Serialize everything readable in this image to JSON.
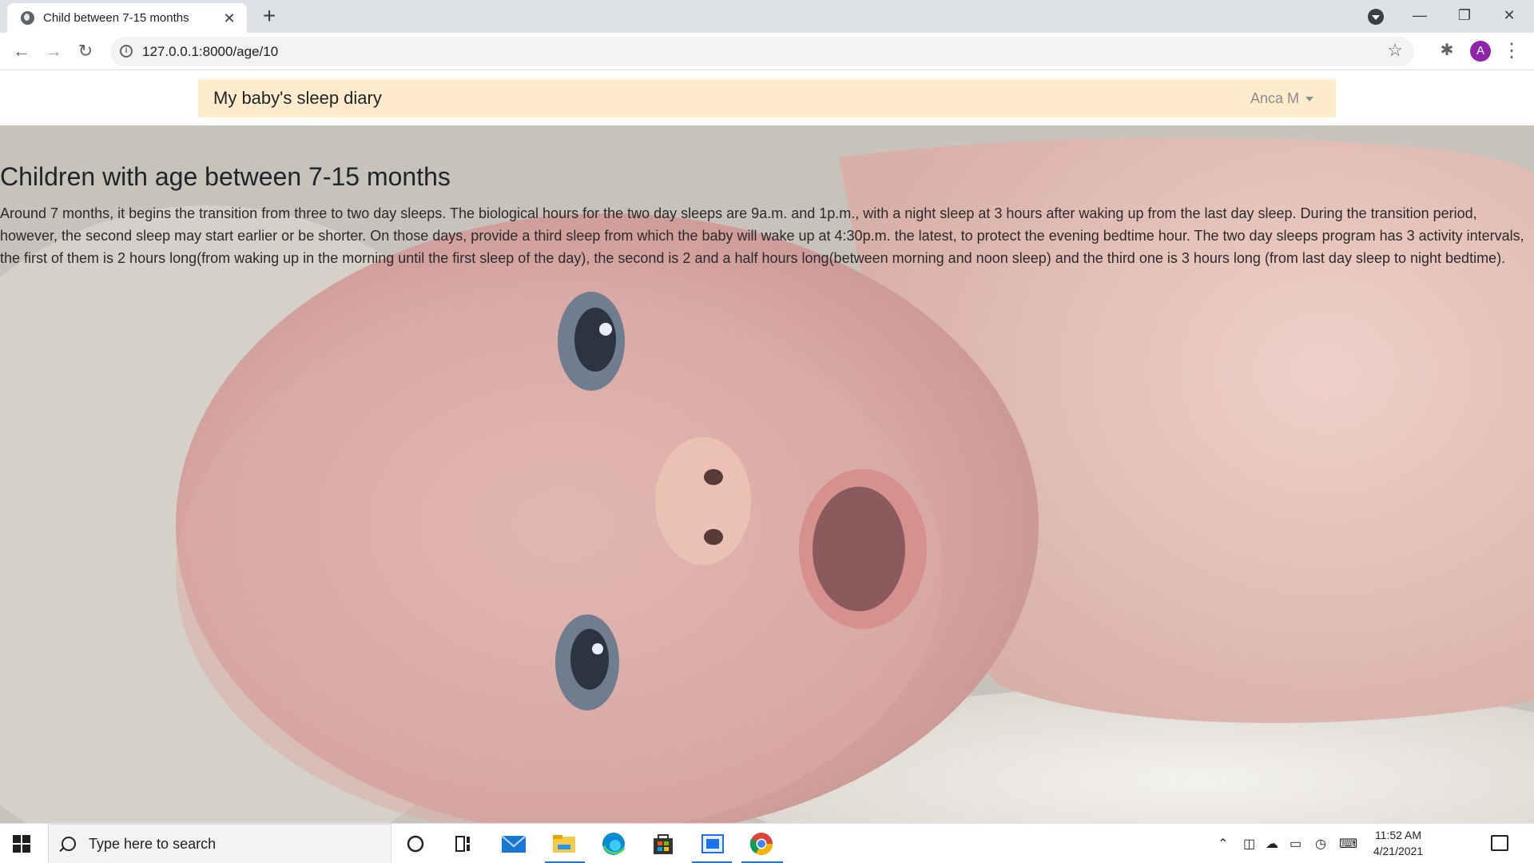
{
  "browser": {
    "tab_title": "Child between 7-15 months",
    "tab_close": "✕",
    "new_tab": "+",
    "url": "127.0.0.1:8000/age/10",
    "info_glyph": "i",
    "star_glyph": "☆",
    "avatar_letter": "A",
    "menu_glyph": "⋮",
    "icons": [
      "globe-favicon-icon",
      "back-icon",
      "forward-icon",
      "reload-icon",
      "info-icon",
      "star-icon",
      "extensions-icon",
      "tab-search-icon",
      "minimize-icon",
      "restore-icon",
      "close-icon"
    ]
  },
  "navbar": {
    "brand": "My baby's sleep diary",
    "user": "Anca M"
  },
  "content": {
    "heading": "Children with age between 7-15 months",
    "paragraph": "Around 7 months, it begins the transition from three to two day sleeps. The biological hours for the two day sleeps are 9a.m. and 1p.m., with a night sleep at 3 hours after waking up from the last day sleep. During the transition period, however, the second sleep may start earlier or be shorter. On those days, provide a third sleep from which the baby will wake up at 4:30p.m. the latest, to protect the evening bedtime hour. The two day sleeps program has 3 activity intervals, the first of them is 2 hours long(from waking up in the morning until the first sleep of the day), the second is 2 and a half hours long(between morning and noon sleep) and the third one is 3 hours long (from last day sleep to night bedtime)."
  },
  "taskbar": {
    "search_placeholder": "Type here to search",
    "time": "11:52 AM",
    "date": "4/21/2021",
    "icons": [
      "windows-start-icon",
      "search-icon",
      "cortana-icon",
      "task-view-icon",
      "mail-icon",
      "file-explorer-icon",
      "edge-icon",
      "store-icon",
      "app-icon",
      "chrome-icon",
      "chevron-up-icon",
      "meet-icon",
      "onedrive-icon",
      "battery-icon",
      "wifi-icon",
      "keyboard-icon",
      "notifications-icon"
    ]
  },
  "colors": {
    "navbar_bg": "#ffeccc",
    "avatar": "#8e24aa",
    "accent": "#1a73e8"
  }
}
